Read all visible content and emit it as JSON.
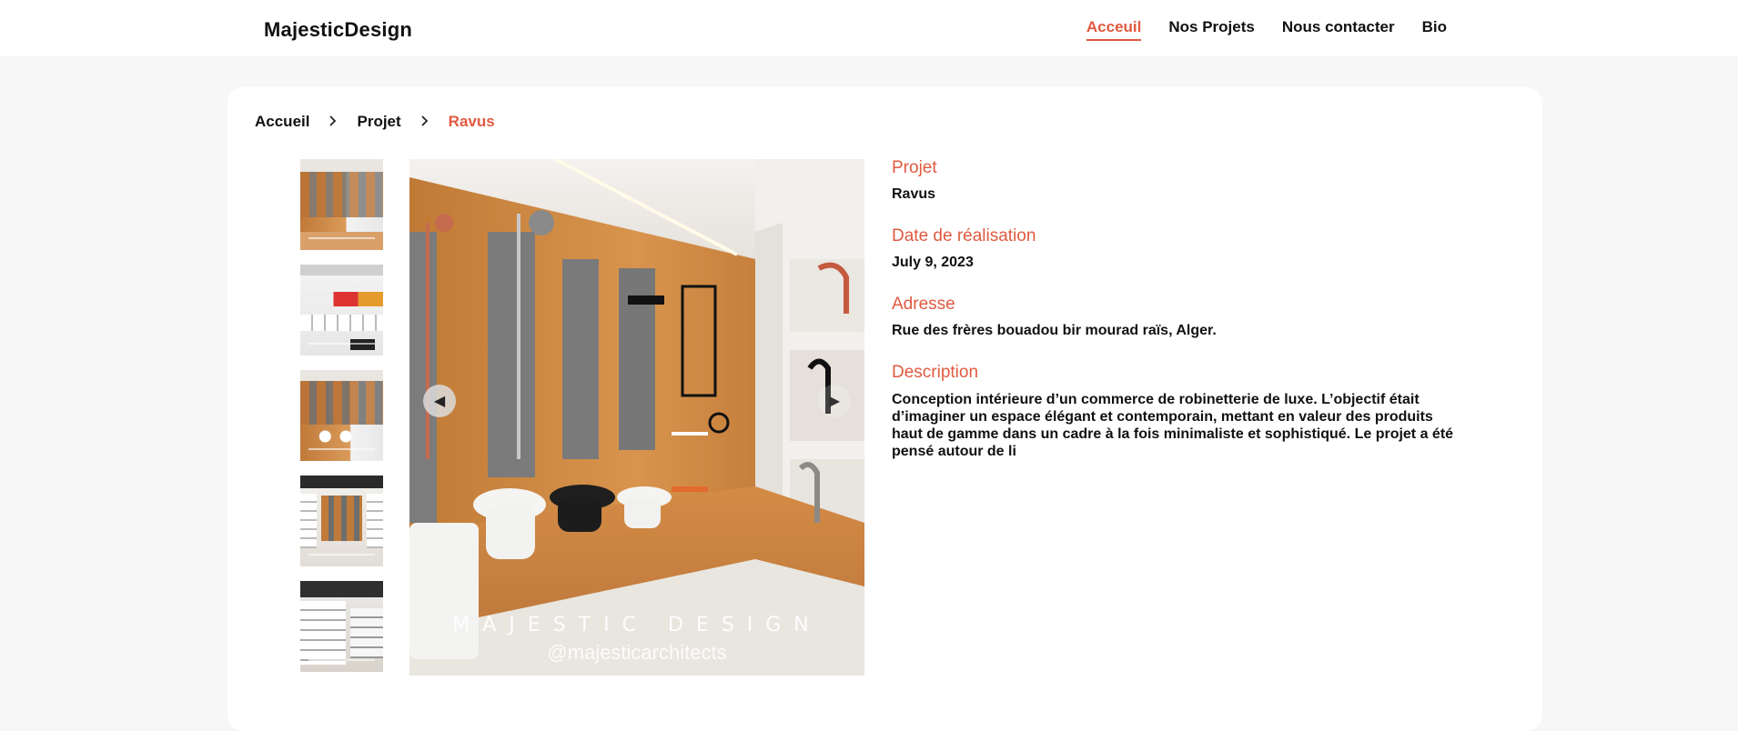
{
  "brand": "MajesticDesign",
  "nav": {
    "items": [
      {
        "label": "Acceuil",
        "active": true
      },
      {
        "label": "Nos Projets",
        "active": false
      },
      {
        "label": "Nous contacter",
        "active": false
      },
      {
        "label": "Bio",
        "active": false
      }
    ]
  },
  "breadcrumb": {
    "items": [
      "Accueil",
      "Projet",
      "Ravus"
    ],
    "separator_icon": "chevron-right-icon"
  },
  "gallery": {
    "watermark_title": "MAJESTIC DESIGN",
    "watermark_handle": "@majesticarchitects",
    "prev_icon": "◀",
    "next_icon": "▶"
  },
  "details": {
    "project_label": "Projet",
    "project_value": "Ravus",
    "date_label": "Date de réalisation",
    "date_value": "July 9, 2023",
    "address_label": "Adresse",
    "address_value": "Rue des frères bouadou bir mourad raïs, Alger.",
    "description_label": "Description",
    "description_value": "Conception intérieure d’un commerce de robinetterie de luxe. L’objectif était d’imaginer un espace élégant et contemporain, mettant en valeur des produits haut de gamme dans un cadre à la fois minimaliste et sophistiqué. Le projet a été pensé autour de li"
  },
  "colors": {
    "accent": "#e05a40",
    "background": "#f7f7f7",
    "card": "#ffffff"
  }
}
